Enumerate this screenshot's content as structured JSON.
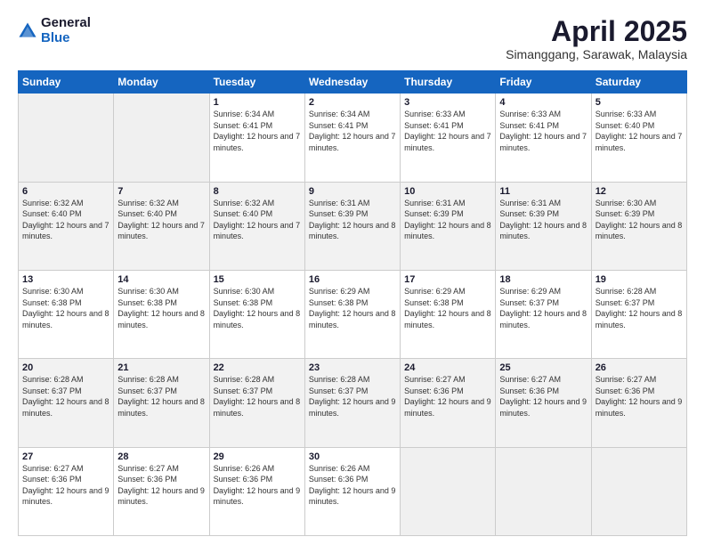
{
  "logo": {
    "general": "General",
    "blue": "Blue"
  },
  "header": {
    "month": "April 2025",
    "location": "Simanggang, Sarawak, Malaysia"
  },
  "days_of_week": [
    "Sunday",
    "Monday",
    "Tuesday",
    "Wednesday",
    "Thursday",
    "Friday",
    "Saturday"
  ],
  "weeks": [
    [
      {
        "day": "",
        "info": ""
      },
      {
        "day": "",
        "info": ""
      },
      {
        "day": "1",
        "info": "Sunrise: 6:34 AM\nSunset: 6:41 PM\nDaylight: 12 hours and 7 minutes."
      },
      {
        "day": "2",
        "info": "Sunrise: 6:34 AM\nSunset: 6:41 PM\nDaylight: 12 hours and 7 minutes."
      },
      {
        "day": "3",
        "info": "Sunrise: 6:33 AM\nSunset: 6:41 PM\nDaylight: 12 hours and 7 minutes."
      },
      {
        "day": "4",
        "info": "Sunrise: 6:33 AM\nSunset: 6:41 PM\nDaylight: 12 hours and 7 minutes."
      },
      {
        "day": "5",
        "info": "Sunrise: 6:33 AM\nSunset: 6:40 PM\nDaylight: 12 hours and 7 minutes."
      }
    ],
    [
      {
        "day": "6",
        "info": "Sunrise: 6:32 AM\nSunset: 6:40 PM\nDaylight: 12 hours and 7 minutes."
      },
      {
        "day": "7",
        "info": "Sunrise: 6:32 AM\nSunset: 6:40 PM\nDaylight: 12 hours and 7 minutes."
      },
      {
        "day": "8",
        "info": "Sunrise: 6:32 AM\nSunset: 6:40 PM\nDaylight: 12 hours and 7 minutes."
      },
      {
        "day": "9",
        "info": "Sunrise: 6:31 AM\nSunset: 6:39 PM\nDaylight: 12 hours and 8 minutes."
      },
      {
        "day": "10",
        "info": "Sunrise: 6:31 AM\nSunset: 6:39 PM\nDaylight: 12 hours and 8 minutes."
      },
      {
        "day": "11",
        "info": "Sunrise: 6:31 AM\nSunset: 6:39 PM\nDaylight: 12 hours and 8 minutes."
      },
      {
        "day": "12",
        "info": "Sunrise: 6:30 AM\nSunset: 6:39 PM\nDaylight: 12 hours and 8 minutes."
      }
    ],
    [
      {
        "day": "13",
        "info": "Sunrise: 6:30 AM\nSunset: 6:38 PM\nDaylight: 12 hours and 8 minutes."
      },
      {
        "day": "14",
        "info": "Sunrise: 6:30 AM\nSunset: 6:38 PM\nDaylight: 12 hours and 8 minutes."
      },
      {
        "day": "15",
        "info": "Sunrise: 6:30 AM\nSunset: 6:38 PM\nDaylight: 12 hours and 8 minutes."
      },
      {
        "day": "16",
        "info": "Sunrise: 6:29 AM\nSunset: 6:38 PM\nDaylight: 12 hours and 8 minutes."
      },
      {
        "day": "17",
        "info": "Sunrise: 6:29 AM\nSunset: 6:38 PM\nDaylight: 12 hours and 8 minutes."
      },
      {
        "day": "18",
        "info": "Sunrise: 6:29 AM\nSunset: 6:37 PM\nDaylight: 12 hours and 8 minutes."
      },
      {
        "day": "19",
        "info": "Sunrise: 6:28 AM\nSunset: 6:37 PM\nDaylight: 12 hours and 8 minutes."
      }
    ],
    [
      {
        "day": "20",
        "info": "Sunrise: 6:28 AM\nSunset: 6:37 PM\nDaylight: 12 hours and 8 minutes."
      },
      {
        "day": "21",
        "info": "Sunrise: 6:28 AM\nSunset: 6:37 PM\nDaylight: 12 hours and 8 minutes."
      },
      {
        "day": "22",
        "info": "Sunrise: 6:28 AM\nSunset: 6:37 PM\nDaylight: 12 hours and 8 minutes."
      },
      {
        "day": "23",
        "info": "Sunrise: 6:28 AM\nSunset: 6:37 PM\nDaylight: 12 hours and 9 minutes."
      },
      {
        "day": "24",
        "info": "Sunrise: 6:27 AM\nSunset: 6:36 PM\nDaylight: 12 hours and 9 minutes."
      },
      {
        "day": "25",
        "info": "Sunrise: 6:27 AM\nSunset: 6:36 PM\nDaylight: 12 hours and 9 minutes."
      },
      {
        "day": "26",
        "info": "Sunrise: 6:27 AM\nSunset: 6:36 PM\nDaylight: 12 hours and 9 minutes."
      }
    ],
    [
      {
        "day": "27",
        "info": "Sunrise: 6:27 AM\nSunset: 6:36 PM\nDaylight: 12 hours and 9 minutes."
      },
      {
        "day": "28",
        "info": "Sunrise: 6:27 AM\nSunset: 6:36 PM\nDaylight: 12 hours and 9 minutes."
      },
      {
        "day": "29",
        "info": "Sunrise: 6:26 AM\nSunset: 6:36 PM\nDaylight: 12 hours and 9 minutes."
      },
      {
        "day": "30",
        "info": "Sunrise: 6:26 AM\nSunset: 6:36 PM\nDaylight: 12 hours and 9 minutes."
      },
      {
        "day": "",
        "info": ""
      },
      {
        "day": "",
        "info": ""
      },
      {
        "day": "",
        "info": ""
      }
    ]
  ]
}
